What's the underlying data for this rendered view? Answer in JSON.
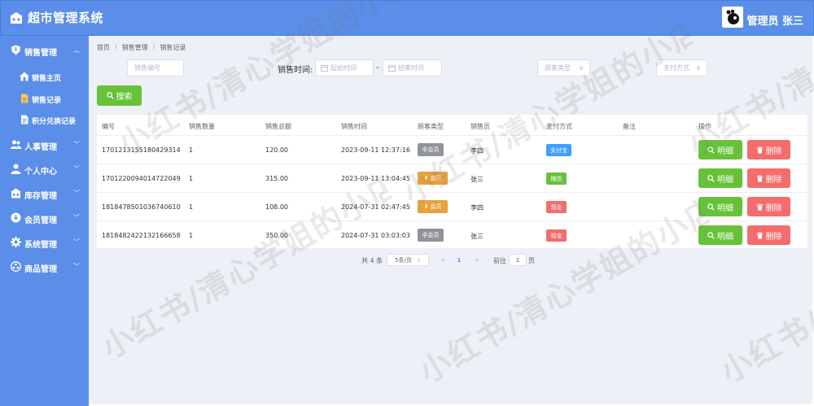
{
  "header": {
    "title": "超市管理系统",
    "user": "管理员 张三"
  },
  "sidebar": {
    "sales_group": "销售管理",
    "sales_items": [
      "销售主页",
      "销售记录",
      "积分兑换记录"
    ],
    "groups": [
      "人事管理",
      "个人中心",
      "库存管理",
      "会员管理",
      "系统管理",
      "商品管理"
    ]
  },
  "breadcrumb": [
    "首页",
    "销售管理",
    "销售记录"
  ],
  "filters": {
    "order_no_placeholder": "销售编号",
    "time_label": "销售时间:",
    "start_placeholder": "起始时间",
    "end_placeholder": "结束时间",
    "dash": "-",
    "customer_type_placeholder": "顾客类型",
    "payment_placeholder": "支付方式",
    "search_label": "搜索"
  },
  "table": {
    "headers": [
      "编号",
      "销售数量",
      "销售总额",
      "销售时间",
      "顾客类型",
      "销售员",
      "支付方式",
      "备注",
      "操作"
    ],
    "rows": [
      {
        "id": "1701213155180429314",
        "qty": "1",
        "total": "120.00",
        "time": "2023-09-11 12:37:16",
        "customer": "非会员",
        "seller": "李四",
        "payment": "支付宝",
        "note": ""
      },
      {
        "id": "1701220094014722049",
        "qty": "1",
        "total": "315.00",
        "time": "2023-09-11 13:04:45",
        "customer": "会员",
        "seller": "张三",
        "payment": "微信",
        "note": ""
      },
      {
        "id": "1818478501036740610",
        "qty": "1",
        "total": "108.00",
        "time": "2024-07-31 02:47:45",
        "customer": "会员",
        "seller": "李四",
        "payment": "现金",
        "note": ""
      },
      {
        "id": "1818482422132166658",
        "qty": "1",
        "total": "350.00",
        "time": "2024-07-31 03:03:03",
        "customer": "非会员",
        "seller": "张三",
        "payment": "现金",
        "note": ""
      }
    ],
    "detail_label": "明细",
    "delete_label": "删除"
  },
  "pagination": {
    "total": "共 4 条",
    "page_size": "5条/页",
    "current_page": "1",
    "goto_label": "前往",
    "goto_value": "1",
    "page_unit": "页"
  },
  "watermark": "小红书/清心学姐的小店",
  "colors": {
    "primary": "#5a8ee8",
    "success": "#67c23a",
    "danger": "#f56c6c",
    "warning": "#e6a23c",
    "info": "#909399",
    "alipay": "#409eff"
  }
}
